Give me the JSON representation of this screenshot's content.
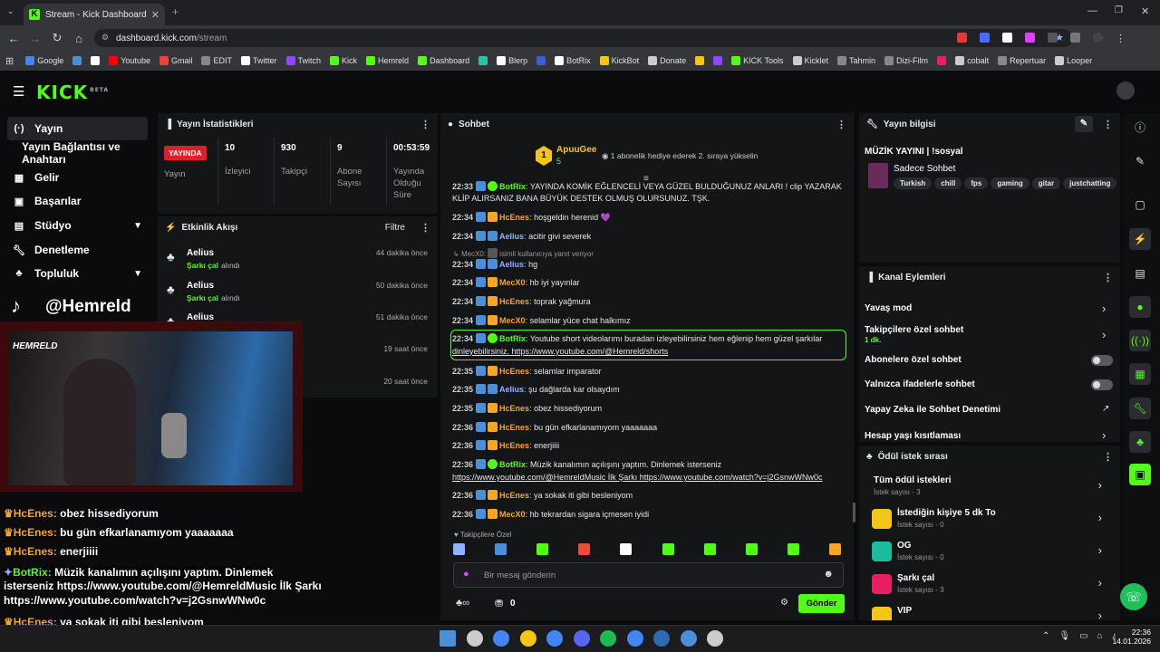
{
  "browser": {
    "tab_title": "Stream - Kick Dashboard",
    "url_domain": "dashboard.kick.com",
    "url_path": "/stream",
    "bookmarks": [
      {
        "label": "Google",
        "color": "#4285f4"
      },
      {
        "label": "",
        "color": "#4a90d9"
      },
      {
        "label": "",
        "color": "#ffffff"
      },
      {
        "label": "Youtube",
        "color": "#ff0000"
      },
      {
        "label": "Gmail",
        "color": "#ea4335"
      },
      {
        "label": "EDIT",
        "color": "#888888"
      },
      {
        "label": "Twitter",
        "color": "#ffffff"
      },
      {
        "label": "Twitch",
        "color": "#9146ff"
      },
      {
        "label": "Kick",
        "color": "#53fc18"
      },
      {
        "label": "Hemreld",
        "color": "#53fc18"
      },
      {
        "label": "Dashboard",
        "color": "#53fc18"
      },
      {
        "label": "",
        "color": "#2ac3a2"
      },
      {
        "label": "Blerp",
        "color": "#ffffff"
      },
      {
        "label": "",
        "color": "#3b5bdb"
      },
      {
        "label": "BotRix",
        "color": "#ffffff"
      },
      {
        "label": "KickBot",
        "color": "#f5c518"
      },
      {
        "label": "Donate",
        "color": "#cccccc"
      },
      {
        "label": "",
        "color": "#f5c518"
      },
      {
        "label": "",
        "color": "#9146ff"
      },
      {
        "label": "KICK Tools",
        "color": "#53fc18"
      },
      {
        "label": "Kicklet",
        "color": "#cccccc"
      },
      {
        "label": "Tahmin",
        "color": "#888888"
      },
      {
        "label": "Dizi-Film",
        "color": "#888888"
      },
      {
        "label": "",
        "color": "#e91e63"
      },
      {
        "label": "cobalt",
        "color": "#cccccc"
      },
      {
        "label": "Repertuar",
        "color": "#888888"
      },
      {
        "label": "Looper",
        "color": "#cccccc"
      }
    ]
  },
  "app": {
    "logo": "KICK",
    "logo_sup": "BETA"
  },
  "sidebar": {
    "items": [
      {
        "label": "Yayın",
        "icon": "broadcast-icon"
      },
      {
        "label": "Yayın Bağlantısı ve Anahtarı",
        "icon": ""
      },
      {
        "label": "Gelir",
        "icon": "chart-icon"
      },
      {
        "label": "Başarılar",
        "icon": "trophy-icon"
      },
      {
        "label": "Stüdyo",
        "icon": "studio-icon"
      },
      {
        "label": "Denetleme",
        "icon": "wrench-icon"
      },
      {
        "label": "Topluluk",
        "icon": "community-icon"
      }
    ]
  },
  "stats": {
    "title": "Yayın İstatistikleri",
    "live_badge": "YAYINDA",
    "live_label": "Yayın",
    "items": [
      {
        "value": "10",
        "label": "İzleyici"
      },
      {
        "value": "930",
        "label": "Takipçi"
      },
      {
        "value": "9",
        "label": "Abone Sayısı"
      },
      {
        "value": "00:53:59",
        "label": "Yayında Olduğu Süre"
      }
    ]
  },
  "activity": {
    "title": "Etkinlik Akışı",
    "filter": "Filtre",
    "events": [
      {
        "name": "Aelius",
        "action": "Şarkı çal",
        "suffix": "alındı",
        "time": "44 dakika önce"
      },
      {
        "name": "Aelius",
        "action": "Şarkı çal",
        "suffix": "alındı",
        "time": "50 dakika önce"
      },
      {
        "name": "Aelius",
        "action": "",
        "suffix": "",
        "time": "51 dakika önce"
      },
      {
        "name": "",
        "action": "",
        "suffix": "",
        "time": "19 saat önce"
      },
      {
        "name": "",
        "action": "",
        "suffix": "",
        "time": "20 saat önce"
      }
    ]
  },
  "overlay": {
    "tiktok": "@Hemreld",
    "cam_logo": "HEMRELD",
    "lines": [
      {
        "user": "HcEnes",
        "text": " obez hissediyorum"
      },
      {
        "user": "HcEnes",
        "text": " bu gün efkarlanamıyom yaaaaaaa"
      },
      {
        "user": "HcEnes",
        "text": " enerjiiii"
      },
      {
        "user": "BotRix",
        "text": " Müzik kanalımın açılışını yaptım. Dinlemek"
      },
      {
        "user": "",
        "text": "isterseniz https://www.youtube.com/@HemreldMusic İlk Şarkı"
      },
      {
        "user": "",
        "text": "https://www.youtube.com/watch?v=j2GsnwWNw0c"
      },
      {
        "user": "HcEnes",
        "text": " ya sokak iti gibi besleniyom"
      },
      {
        "user": "MecX0",
        "text": " hb tekrardan sigara içmesen iyidi"
      }
    ]
  },
  "chat": {
    "title": "Sohbet",
    "pinned_user": "ApuuGee",
    "pinned_count": "5",
    "pinned_text": "1 abonelik hediye ederek 2. sıraya yükselin",
    "reply_hint": "isimli kullanıcıya yanıt veriyor",
    "reply_user": "MecX0",
    "messages": [
      {
        "t": "22:33",
        "u": "BotRix",
        "c": "#53fc18",
        "m": "YAYINDA KOMİK EĞLENCELİ VEYA GÜZEL BULDUĞUNUZ ANLARI ! clip YAZARAK"
      },
      {
        "t": "",
        "u": "",
        "c": "",
        "m": "KLİP ALIRSANIZ BANA BÜYÜK DESTEK OLMUŞ OLURSUNUZ. TŞK."
      },
      {
        "t": "22:34",
        "u": "HcEnes",
        "c": "#f5a623",
        "m": "hoşgeldin herenid 💜"
      },
      {
        "t": "22:34",
        "u": "Aelius",
        "c": "#8fb4ff",
        "m": "acitir givi severek"
      },
      {
        "t": "22:34",
        "u": "Aelius",
        "c": "#8fb4ff",
        "m": "hg"
      },
      {
        "t": "22:34",
        "u": "MecX0",
        "c": "#f5a623",
        "m": "hb iyi yayınlar"
      },
      {
        "t": "22:34",
        "u": "HcEnes",
        "c": "#f5a623",
        "m": "toprak yağmura"
      },
      {
        "t": "22:34",
        "u": "MecX0",
        "c": "#f5a623",
        "m": "selamlar yüce chat halkımız"
      },
      {
        "t": "22:34",
        "u": "BotRix",
        "c": "#53fc18",
        "m": "Youtube short videolarımı buradan izleyebilirsiniz hem eğlenip hem güzel şarkılar"
      },
      {
        "t": "",
        "u": "",
        "c": "",
        "m": "dinleyebilirsiniz. https://www.youtube.com/@Hemreld/shorts"
      },
      {
        "t": "22:35",
        "u": "HcEnes",
        "c": "#f5a623",
        "m": "selamlar imparator"
      },
      {
        "t": "22:35",
        "u": "Aelius",
        "c": "#8fb4ff",
        "m": "şu dağlarda kar olsaydım"
      },
      {
        "t": "22:35",
        "u": "HcEnes",
        "c": "#f5a623",
        "m": "obez hissediyorum"
      },
      {
        "t": "22:36",
        "u": "HcEnes",
        "c": "#f5a623",
        "m": "bu gün efkarlanamıyom yaaaaaaa"
      },
      {
        "t": "22:36",
        "u": "HcEnes",
        "c": "#f5a623",
        "m": "enerjiiii"
      },
      {
        "t": "22:36",
        "u": "BotRix",
        "c": "#53fc18",
        "m": "Müzik kanalımın açılışını yaptım. Dinlemek isterseniz"
      },
      {
        "t": "",
        "u": "",
        "c": "",
        "m": "https://www.youtube.com/@HemreldMusic İlk Şarkı https://www.youtube.com/watch?v=j2GsnwWNw0c"
      },
      {
        "t": "22:36",
        "u": "HcEnes",
        "c": "#f5a623",
        "m": "ya sokak iti gibi besleniyom"
      },
      {
        "t": "22:36",
        "u": "MecX0",
        "c": "#f5a623",
        "m": "hb tekrardan sigara içmesen iyidi"
      }
    ],
    "followers_only": "Takipçilere Özel",
    "input_placeholder": "Bir mesaj gönderin",
    "points": "0",
    "send": "Gönder"
  },
  "stream_info": {
    "title": "Yayın bilgisi",
    "stream_title": "MÜZİK YAYINI | !sosyal",
    "category": "Sadece Sohbet",
    "tags": [
      "Turkish",
      "chill",
      "fps",
      "gaming",
      "gitar",
      "justchatting"
    ]
  },
  "channel_actions": {
    "title": "Kanal Eylemleri",
    "items": [
      {
        "label": "Yavaş mod",
        "sub": ""
      },
      {
        "label": "Takipçilere özel sohbet",
        "sub": "1 dk."
      },
      {
        "label": "Abonelere özel sohbet",
        "sub": ""
      },
      {
        "label": "Yalnızca ifadelerle sohbet",
        "sub": ""
      },
      {
        "label": "Yapay Zeka ile Sohbet Denetimi",
        "sub": ""
      },
      {
        "label": "Hesap yaşı kısıtlaması",
        "sub": ""
      }
    ]
  },
  "rewards": {
    "title": "Ödül istek sırası",
    "items": [
      {
        "name": "Tüm ödül istekleri",
        "count": "İstek sayısı - 3",
        "color": ""
      },
      {
        "name": "İstediğin kişiye 5 dk To",
        "count": "İstek sayısı - 0",
        "color": "#f5c518"
      },
      {
        "name": "OG",
        "count": "İstek sayısı - 0",
        "color": "#1abc9c"
      },
      {
        "name": "Şarkı çal",
        "count": "İstek sayısı - 3",
        "color": "#e91e63"
      },
      {
        "name": "VIP",
        "count": "",
        "color": "#f5c518"
      }
    ]
  },
  "taskbar": {
    "time": "22:36",
    "date": "14.01.2026"
  }
}
